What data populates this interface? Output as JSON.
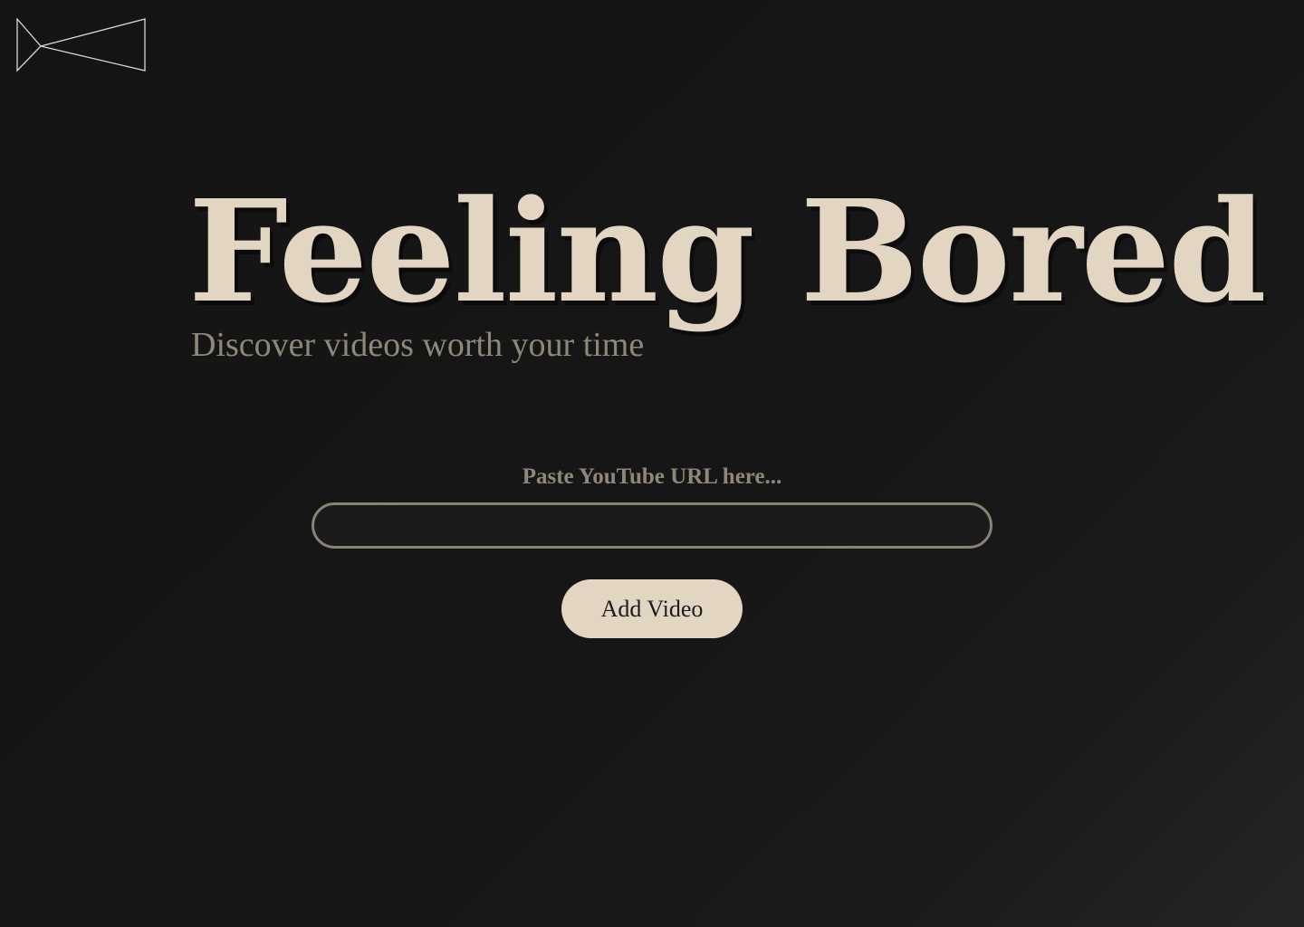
{
  "hero": {
    "title": "Feeling Bored",
    "subtitle": "Discover videos worth your time"
  },
  "form": {
    "label": "Paste YouTube URL here...",
    "input_value": "",
    "button_label": "Add Video"
  },
  "colors": {
    "background": "#151515",
    "accent": "#e2d6c2",
    "muted_text": "#8f877a",
    "input_border": "#8a8275",
    "logo_stroke": "#d9d9d9"
  },
  "icons": {
    "logo": "bowtie-logo-icon"
  }
}
